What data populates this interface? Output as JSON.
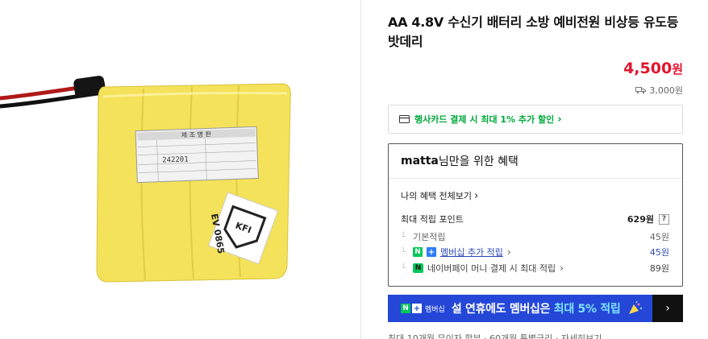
{
  "product": {
    "title": "AA 4.8V 수신기 배터리 소방 예비전원 비상등 유도등 밧데리",
    "price_value": "4,500",
    "price_unit": "원",
    "shipping_fee": "3,000원"
  },
  "image_label": {
    "header": "제 조 명 판",
    "code": "242201",
    "sticker": "KFI",
    "sticker_code": "EV 0865"
  },
  "card_promo": {
    "text": "행사카드 결제 시 최대 1% 추가 할인",
    "chevron": "›"
  },
  "benefits": {
    "user": "matta",
    "header_rest": "님만을 위한 혜택",
    "my_benefits_link": "나의 혜택 전체보기",
    "max_points_label": "최대 적립 포인트",
    "max_points_value": "629원",
    "help": "?",
    "basic_label": "기본적립",
    "basic_value": "45원",
    "membership_label": "멤버십 추가 적립",
    "membership_value": "45원",
    "pay_label": "네이버페이 머니 결제 시 최대 적립",
    "pay_value": "89원"
  },
  "banner": {
    "logo_n": "N",
    "logo_plus": "+",
    "logo_text": "멤버십",
    "text_before": "설 연휴에도 멤버십은 ",
    "text_highlight": "최대 5% 적립",
    "arrow": "›"
  },
  "footer_cutoff": "최대 10개월 무이자 할부 · 60개월 특별금리 · 자세히보기"
}
